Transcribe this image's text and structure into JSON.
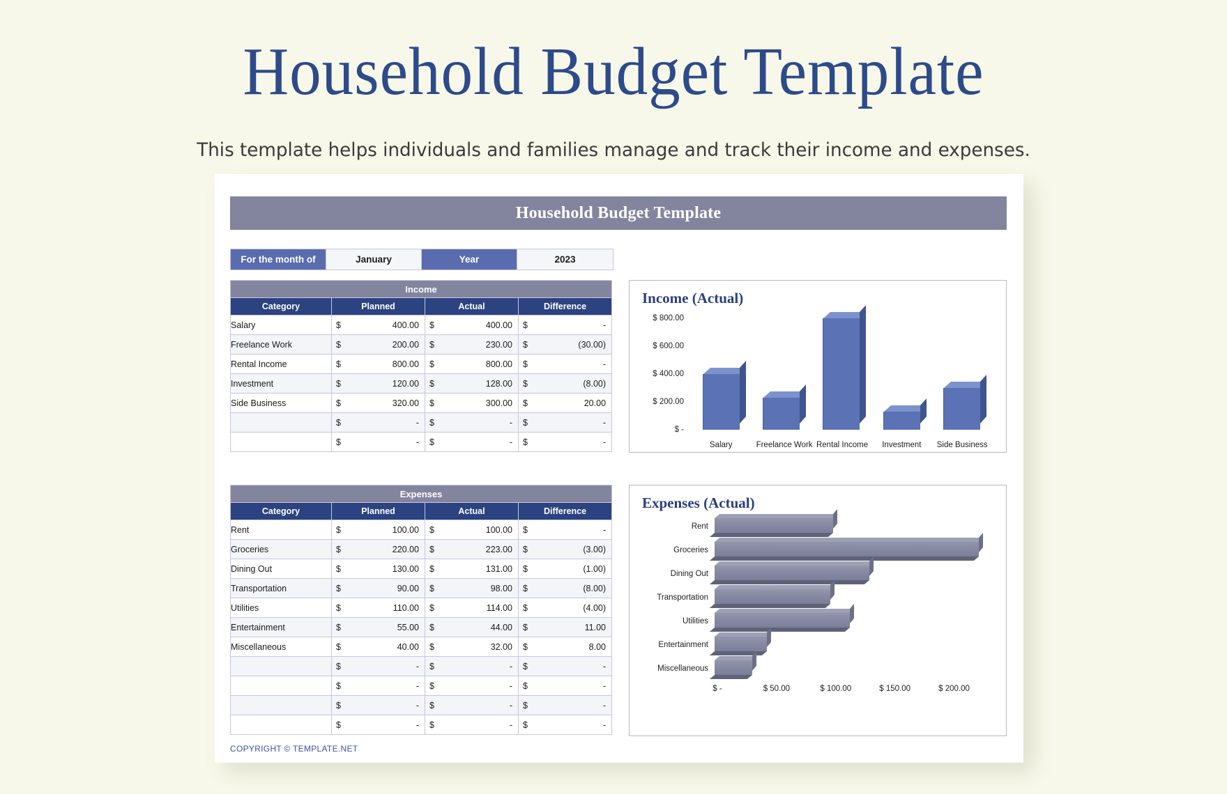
{
  "page": {
    "title": "Household Budget Template",
    "subtitle": "This template helps individuals and families manage and track their income and expenses.",
    "background_color": "#f7f8e9",
    "title_color": "#2d4a8a"
  },
  "sheet": {
    "title_bar": "Household Budget Template",
    "title_bar_color": "#83859e",
    "copyright": "COPYRIGHT © TEMPLATE.NET"
  },
  "meta": {
    "month_label": "For the month of",
    "month_value": "January",
    "year_label": "Year",
    "year_value": "2023",
    "label_color": "#5a6cb0"
  },
  "income_table": {
    "section_title": "Income",
    "columns": [
      "Category",
      "Planned",
      "Actual",
      "Difference"
    ],
    "header_color": "#2b4380",
    "rows": [
      {
        "category": "Salary",
        "planned_sign": "$",
        "planned": "400.00",
        "actual_sign": "$",
        "actual": "400.00",
        "difference_sign": "$",
        "difference": "-"
      },
      {
        "category": "Freelance Work",
        "planned_sign": "$",
        "planned": "200.00",
        "actual_sign": "$",
        "actual": "230.00",
        "difference_sign": "$",
        "difference": "(30.00)"
      },
      {
        "category": "Rental Income",
        "planned_sign": "$",
        "planned": "800.00",
        "actual_sign": "$",
        "actual": "800.00",
        "difference_sign": "$",
        "difference": "-"
      },
      {
        "category": "Investment",
        "planned_sign": "$",
        "planned": "120.00",
        "actual_sign": "$",
        "actual": "128.00",
        "difference_sign": "$",
        "difference": "(8.00)"
      },
      {
        "category": "Side Business",
        "planned_sign": "$",
        "planned": "320.00",
        "actual_sign": "$",
        "actual": "300.00",
        "difference_sign": "$",
        "difference": "20.00"
      },
      {
        "category": "",
        "planned_sign": "$",
        "planned": "-",
        "actual_sign": "$",
        "actual": "-",
        "difference_sign": "$",
        "difference": "-"
      },
      {
        "category": "",
        "planned_sign": "$",
        "planned": "-",
        "actual_sign": "$",
        "actual": "-",
        "difference_sign": "$",
        "difference": "-"
      }
    ]
  },
  "expenses_table": {
    "section_title": "Expenses",
    "columns": [
      "Category",
      "Planned",
      "Actual",
      "Difference"
    ],
    "header_color": "#2b4380",
    "rows": [
      {
        "category": "Rent",
        "planned_sign": "$",
        "planned": "100.00",
        "actual_sign": "$",
        "actual": "100.00",
        "difference_sign": "$",
        "difference": "-"
      },
      {
        "category": "Groceries",
        "planned_sign": "$",
        "planned": "220.00",
        "actual_sign": "$",
        "actual": "223.00",
        "difference_sign": "$",
        "difference": "(3.00)"
      },
      {
        "category": "Dining Out",
        "planned_sign": "$",
        "planned": "130.00",
        "actual_sign": "$",
        "actual": "131.00",
        "difference_sign": "$",
        "difference": "(1.00)"
      },
      {
        "category": "Transportation",
        "planned_sign": "$",
        "planned": "90.00",
        "actual_sign": "$",
        "actual": "98.00",
        "difference_sign": "$",
        "difference": "(8.00)"
      },
      {
        "category": "Utilities",
        "planned_sign": "$",
        "planned": "110.00",
        "actual_sign": "$",
        "actual": "114.00",
        "difference_sign": "$",
        "difference": "(4.00)"
      },
      {
        "category": "Entertainment",
        "planned_sign": "$",
        "planned": "55.00",
        "actual_sign": "$",
        "actual": "44.00",
        "difference_sign": "$",
        "difference": "11.00"
      },
      {
        "category": "Miscellaneous",
        "planned_sign": "$",
        "planned": "40.00",
        "actual_sign": "$",
        "actual": "32.00",
        "difference_sign": "$",
        "difference": "8.00"
      },
      {
        "category": "",
        "planned_sign": "$",
        "planned": "-",
        "actual_sign": "$",
        "actual": "-",
        "difference_sign": "$",
        "difference": "-"
      },
      {
        "category": "",
        "planned_sign": "$",
        "planned": "-",
        "actual_sign": "$",
        "actual": "-",
        "difference_sign": "$",
        "difference": "-"
      },
      {
        "category": "",
        "planned_sign": "$",
        "planned": "-",
        "actual_sign": "$",
        "actual": "-",
        "difference_sign": "$",
        "difference": "-"
      },
      {
        "category": "",
        "planned_sign": "$",
        "planned": "-",
        "actual_sign": "$",
        "actual": "-",
        "difference_sign": "$",
        "difference": "-"
      }
    ]
  },
  "chart_data": [
    {
      "id": "income_actual",
      "type": "bar",
      "title": "Income (Actual)",
      "orientation": "vertical",
      "categories": [
        "Salary",
        "Freelance Work",
        "Rental Income",
        "Investment",
        "Side Business"
      ],
      "values": [
        400,
        230,
        800,
        128,
        300
      ],
      "series": [
        {
          "name": "Actual",
          "values": [
            400,
            230,
            800,
            128,
            300
          ]
        }
      ],
      "ylim": [
        0,
        800
      ],
      "yticks": [
        0,
        200,
        400,
        600,
        800
      ],
      "ytick_labels": [
        "$ -",
        "$ 200.00",
        "$ 400.00",
        "$ 600.00",
        "$ 800.00"
      ],
      "xlabel": "",
      "ylabel": "",
      "grid": false,
      "legend": false,
      "bar_color": "#5b72b5",
      "bar_top_color": "#7c92cd",
      "bar_side_color": "#3f558f",
      "title_color": "#2b3f7e"
    },
    {
      "id": "expenses_actual",
      "type": "bar",
      "title": "Expenses (Actual)",
      "orientation": "horizontal",
      "categories": [
        "Rent",
        "Groceries",
        "Dining Out",
        "Transportation",
        "Utilities",
        "Entertainment",
        "Miscellaneous"
      ],
      "values": [
        100,
        223,
        131,
        98,
        114,
        44,
        32
      ],
      "series": [
        {
          "name": "Actual",
          "values": [
            100,
            223,
            131,
            98,
            114,
            44,
            32
          ]
        }
      ],
      "xlim": [
        0,
        225
      ],
      "xticks": [
        0,
        50,
        100,
        150,
        200
      ],
      "xtick_labels": [
        "$ -",
        "$ 50.00",
        "$ 100.00",
        "$ 150.00",
        "$ 200.00"
      ],
      "xlabel": "",
      "ylabel": "",
      "grid": false,
      "legend": false,
      "bar_color": "#8387a0",
      "bar_top_color": "#9ea1b4",
      "bar_side_color": "#6c7087",
      "title_color": "#2b3f7e"
    }
  ]
}
